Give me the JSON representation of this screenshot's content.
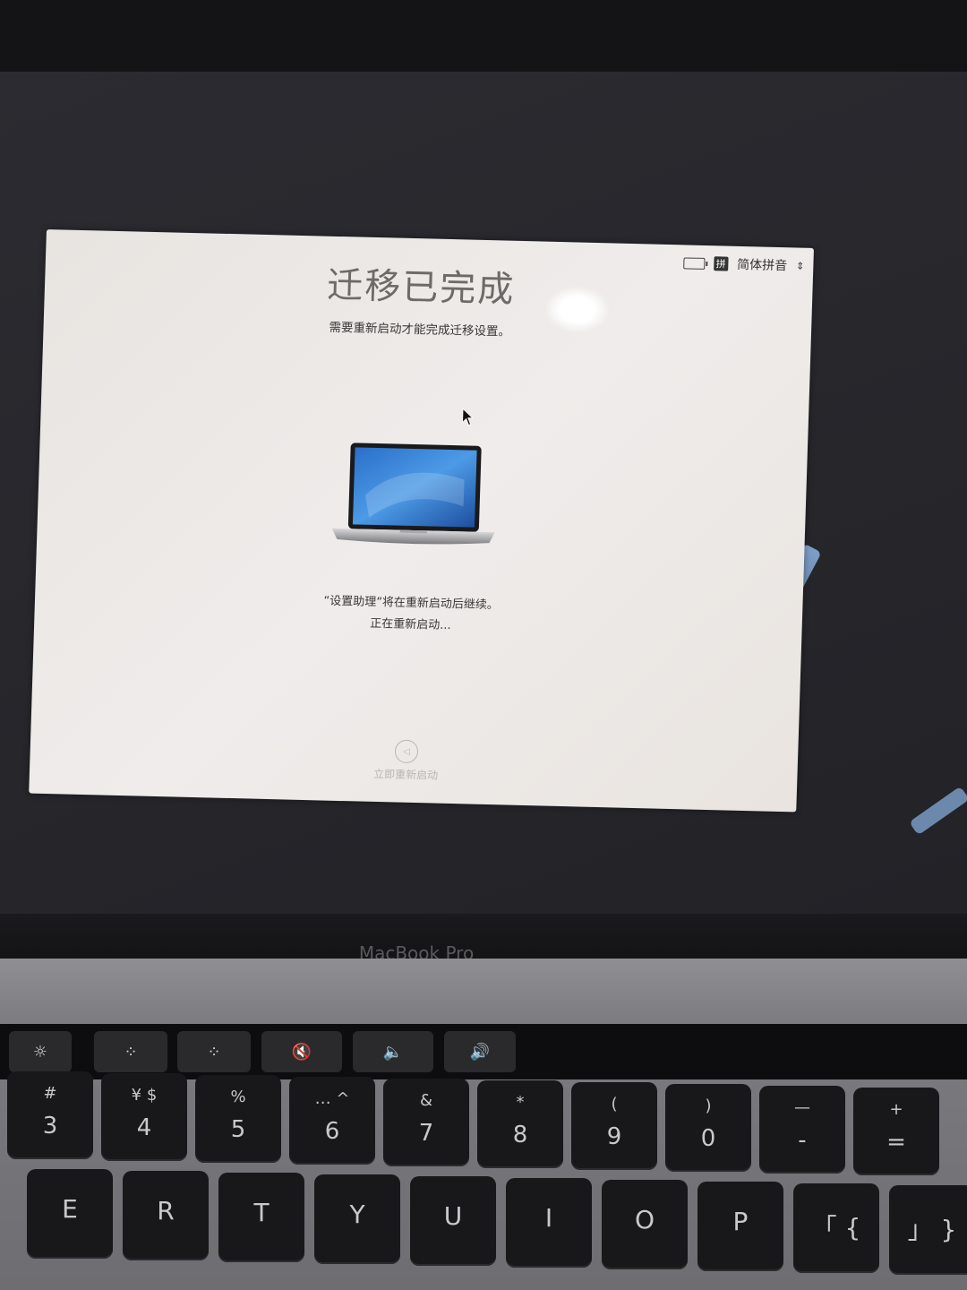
{
  "window": {
    "title": "迁移已完成",
    "subtitle": "需要重新启动才能完成迁移设置。",
    "message_line1": "“设置助理”将在重新启动后继续。",
    "message_line2": "正在重新启动...",
    "restart_button_label": "立即重新启动"
  },
  "status_bar": {
    "input_method_glyph": "拼",
    "input_method_label": "简体拼音",
    "icons": [
      "battery-charging-icon",
      "input-method-icon",
      "chevron-updown-icon"
    ]
  },
  "hardware": {
    "brand": "MacBook Pro",
    "touchbar": [
      "☼",
      "⁘",
      "⁘",
      "🔇",
      "🔈",
      "🔊"
    ],
    "keys_row1": [
      {
        "top": "#",
        "bot": "3"
      },
      {
        "top": "¥ $",
        "bot": "4"
      },
      {
        "top": "%",
        "bot": "5"
      },
      {
        "top": "… ^",
        "bot": "6"
      },
      {
        "top": "&",
        "bot": "7"
      },
      {
        "top": "*",
        "bot": "8"
      },
      {
        "top": "(",
        "bot": "9"
      },
      {
        "top": ")",
        "bot": "0"
      },
      {
        "top": "—",
        "bot": "-"
      },
      {
        "top": "+",
        "bot": "="
      }
    ],
    "keys_row2": [
      "E",
      "R",
      "T",
      "Y",
      "U",
      "I",
      "O",
      "P",
      "「 {",
      "」 }"
    ]
  }
}
